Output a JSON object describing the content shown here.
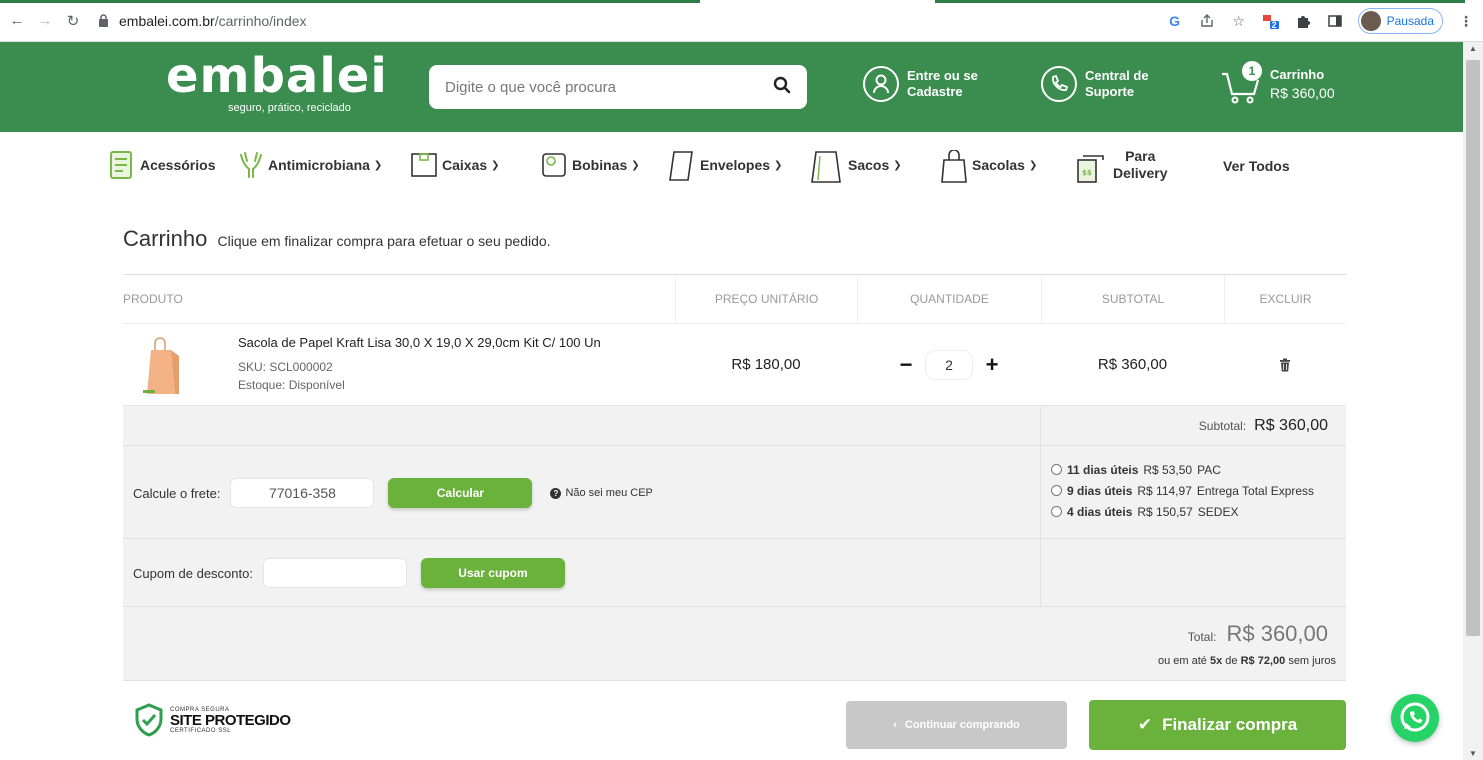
{
  "browser": {
    "url_host": "embalei.com.br",
    "url_path": "/carrinho/index",
    "profile_label": "Pausada",
    "extension_badge": "2"
  },
  "header": {
    "logo_word": "embalei",
    "logo_tagline": "seguro, prático, reciclado",
    "search_placeholder": "Digite o que você procura",
    "login_line1": "Entre ou se",
    "login_line2": "Cadastre",
    "support_line1": "Central de",
    "support_line2": "Suporte",
    "cart_label": "Carrinho",
    "cart_value": "R$ 360,00",
    "cart_count": "1"
  },
  "categories": [
    {
      "label": "Acessórios"
    },
    {
      "label": "Antimicrobiana"
    },
    {
      "label": "Caixas"
    },
    {
      "label": "Bobinas"
    },
    {
      "label": "Envelopes"
    },
    {
      "label": "Sacos"
    },
    {
      "label": "Sacolas"
    },
    {
      "label_line1": "Para",
      "label_line2": "Delivery"
    },
    {
      "label": "Ver Todos"
    }
  ],
  "cart": {
    "title": "Carrinho",
    "subtitle": "Clique em finalizar compra para efetuar o seu pedido.",
    "columns": {
      "product": "PRODUTO",
      "unit_price": "PREÇO UNITÁRIO",
      "quantity": "QUANTIDADE",
      "subtotal": "SUBTOTAL",
      "remove": "EXCLUIR"
    },
    "item": {
      "name": "Sacola de Papel Kraft Lisa 30,0 X 19,0 X 29,0cm Kit C/ 100 Un",
      "sku": "SKU: SCL000002",
      "stock": "Estoque: Disponível",
      "unit_price": "R$ 180,00",
      "quantity": "2",
      "subtotal": "R$ 360,00"
    },
    "subtotal_label": "Subtotal:",
    "subtotal_value": "R$ 360,00",
    "shipping": {
      "label": "Calcule o frete:",
      "cep": "77016-358",
      "button": "Calcular",
      "help": "Não sei meu CEP",
      "options": [
        {
          "days": "11 dias úteis",
          "price": "R$ 53,50",
          "service": "PAC"
        },
        {
          "days": "9 dias úteis",
          "price": "R$ 114,97",
          "service": "Entrega Total Express"
        },
        {
          "days": "4 dias úteis",
          "price": "R$ 150,57",
          "service": "SEDEX"
        }
      ]
    },
    "coupon": {
      "label": "Cupom de desconto:",
      "value": "",
      "button": "Usar cupom"
    },
    "total_label": "Total:",
    "total_value": "R$ 360,00",
    "installments_prefix": "ou em até",
    "installments_count": "5x",
    "installments_mid": "de",
    "installments_value": "R$ 72,00",
    "installments_suffix": "sem juros"
  },
  "footer": {
    "seal_line1": "COMPRA SEGURA",
    "seal_line2": "SITE PROTEGIDO",
    "seal_line3": "CERTIFICADO SSL",
    "continue_button": "Continuar comprando",
    "finalize_button": "Finalizar compra"
  },
  "colors": {
    "brand_green": "#3a8d4e",
    "button_green": "#6bb23c",
    "whatsapp": "#25d366"
  }
}
